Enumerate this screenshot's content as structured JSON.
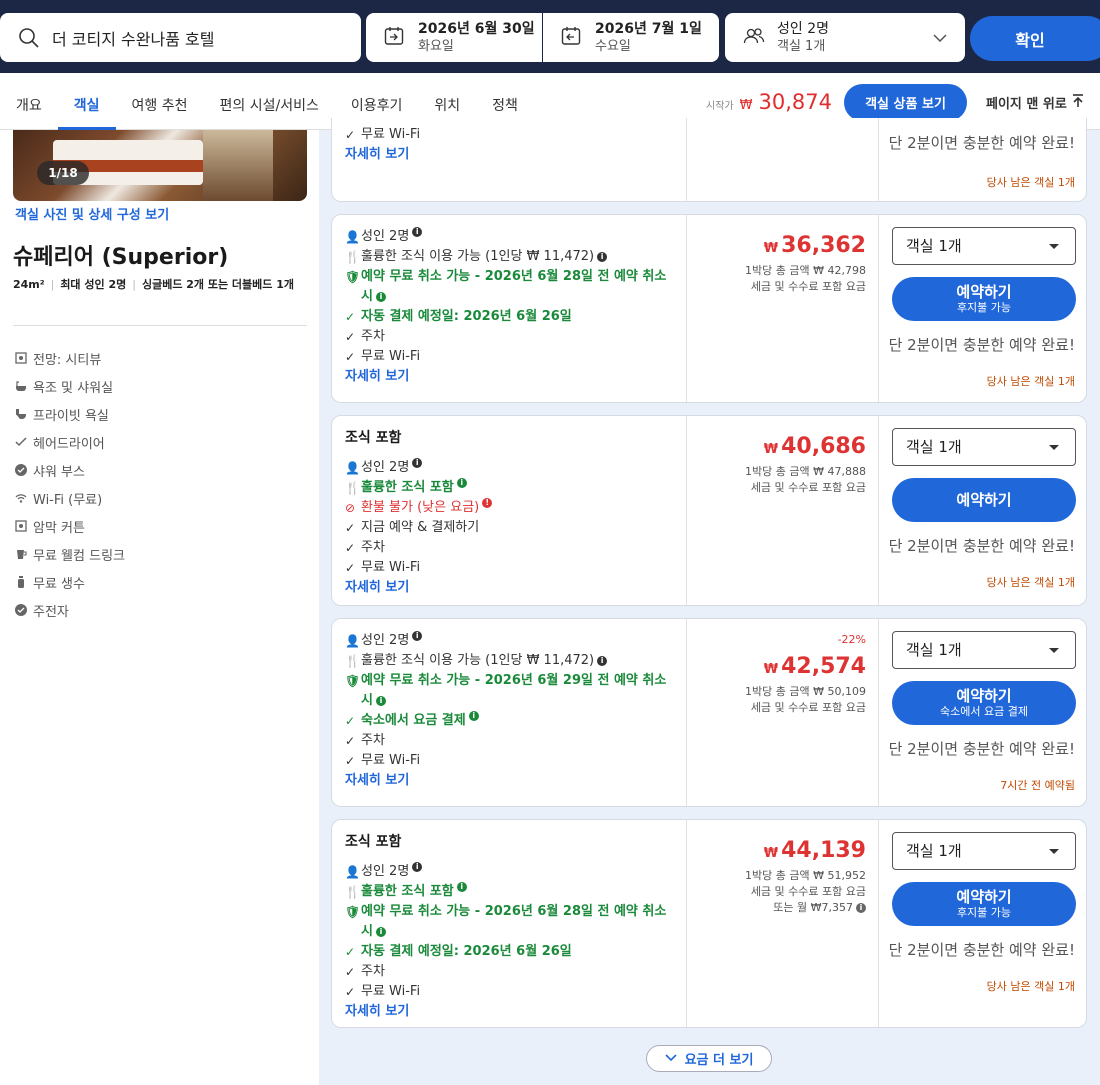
{
  "search": {
    "query": "더 코티지 수완나품 호텔"
  },
  "checkin": {
    "date": "2026년 6월 30일",
    "day": "화요일"
  },
  "checkout": {
    "date": "2026년 7월 1일",
    "day": "수요일"
  },
  "guests": {
    "adults": "성인 2명",
    "rooms": "객실 1개"
  },
  "confirm_label": "확인",
  "nav": {
    "tabs": [
      "개요",
      "객실",
      "여행 추천",
      "편의 시설/서비스",
      "이용후기",
      "위치",
      "정책"
    ],
    "start_label": "시작가",
    "currency": "₩",
    "start_price": "30,874",
    "room_offers_button": "객실 상품 보기",
    "back_to_top": "페이지 맨 위로"
  },
  "room": {
    "photo_counter": "1/18",
    "view_photos": "객실 사진 및 상세 구성 보기",
    "name": "슈페리어 (Superior)",
    "size": "24m²",
    "max_guests": "최대 성인 2명",
    "beds": "싱글베드 2개 또는 더블베드 1개",
    "amenities": [
      "전망: 시티뷰",
      "욕조 및 샤워실",
      "프라이빗 욕실",
      "헤어드라이어",
      "샤워 부스",
      "Wi-Fi (무료)",
      "암막 커튼",
      "무료 웰컴 드링크",
      "무료 생수",
      "주전자"
    ]
  },
  "top_partial": {
    "wifi": "무료 Wi-Fi",
    "details": "자세히 보기",
    "hint": "단 2분이면 충분한 예약 완료!",
    "avail": "당사 남은 객실 1개"
  },
  "offers": [
    {
      "title": "",
      "features": {
        "guests": "성인 2명",
        "breakfast": "훌륭한 조식 이용 가능 (1인당 ₩ 11,472)",
        "cancel": "예약 무료 취소 가능 - 2026년 6월 28일 전 예약 취소 시",
        "payment": "자동 결제 예정일: 2026년 6월 26일",
        "parking": "주차",
        "wifi": "무료 Wi-Fi",
        "details": "자세히 보기"
      },
      "discount": "",
      "price": "36,362",
      "total": "1박당 총 금액 ₩ 42,798",
      "taxes": "세금 및 수수료 포함 요금",
      "monthly": "",
      "room_select": "객실 1개",
      "book": "예약하기",
      "book_sub": "후지불 가능",
      "hint": "단 2분이면 충분한 예약 완료!",
      "avail": "당사 남은 객실 1개"
    },
    {
      "title": "조식 포함",
      "features": {
        "guests": "성인 2명",
        "breakfast": "훌륭한 조식 포함",
        "cancel": "환불 불가 (낮은 요금)",
        "payment": "지금 예약 & 결제하기",
        "parking": "주차",
        "wifi": "무료 Wi-Fi",
        "details": "자세히 보기"
      },
      "discount": "",
      "price": "40,686",
      "total": "1박당 총 금액 ₩ 47,888",
      "taxes": "세금 및 수수료 포함 요금",
      "monthly": "",
      "room_select": "객실 1개",
      "book": "예약하기",
      "book_sub": "",
      "hint": "단 2분이면 충분한 예약 완료!",
      "avail": "당사 남은 객실 1개"
    },
    {
      "title": "",
      "features": {
        "guests": "성인 2명",
        "breakfast": "훌륭한 조식 이용 가능 (1인당 ₩ 11,472)",
        "cancel": "예약 무료 취소 가능 - 2026년 6월 29일 전 예약 취소 시",
        "payment": "숙소에서 요금 결제",
        "parking": "주차",
        "wifi": "무료 Wi-Fi",
        "details": "자세히 보기"
      },
      "discount": "-22%",
      "price": "42,574",
      "total": "1박당 총 금액 ₩ 50,109",
      "taxes": "세금 및 수수료 포함 요금",
      "monthly": "",
      "room_select": "객실 1개",
      "book": "예약하기",
      "book_sub": "숙소에서 요금 결제",
      "hint": "단 2분이면 충분한 예약 완료!",
      "avail": "7시간 전 예약됨"
    },
    {
      "title": "조식 포함",
      "features": {
        "guests": "성인 2명",
        "breakfast": "훌륭한 조식 포함",
        "cancel": "예약 무료 취소 가능 - 2026년 6월 28일 전 예약 취소 시",
        "payment": "자동 결제 예정일: 2026년 6월 26일",
        "parking": "주차",
        "wifi": "무료 Wi-Fi",
        "details": "자세히 보기"
      },
      "discount": "",
      "price": "44,139",
      "total": "1박당 총 금액 ₩ 51,952",
      "taxes": "세금 및 수수료 포함 요금",
      "monthly": "또는 월 ₩7,357",
      "room_select": "객실 1개",
      "book": "예약하기",
      "book_sub": "후지불 가능",
      "hint": "단 2분이면 충분한 예약 완료!",
      "avail": "당사 남은 객실 1개"
    }
  ],
  "more_rates": "요금 더 보기",
  "colors": {
    "brand_blue": "#2067da",
    "top_bar": "#1c2745",
    "price_red": "#d33",
    "green": "#1a8a3a"
  }
}
